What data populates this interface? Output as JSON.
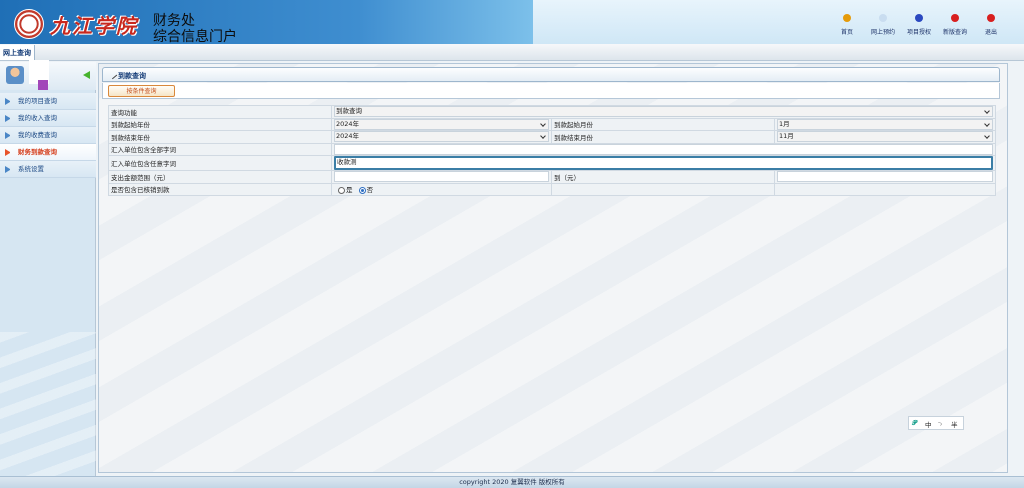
{
  "header": {
    "school_name": "九江学院",
    "title_line1": "财务处",
    "title_line2": "综合信息门户",
    "nav": [
      {
        "label": "首页",
        "color": "#e59b0b"
      },
      {
        "label": "网上预约",
        "color": "#c9ddf0"
      },
      {
        "label": "项目授权",
        "color": "#2a48c0"
      },
      {
        "label": "新版查询",
        "color": "#d81f1f"
      },
      {
        "label": "退出",
        "color": "#d81f1f"
      }
    ]
  },
  "tab": {
    "label": "网上查询"
  },
  "sidebar": {
    "items": [
      {
        "label": "我的项目查询"
      },
      {
        "label": "我的收入查询"
      },
      {
        "label": "我的收费查询"
      },
      {
        "label": "财务到款查询"
      },
      {
        "label": "系统设置"
      }
    ]
  },
  "panel": {
    "title": "到款查询",
    "query_button": "按条件查询"
  },
  "form": {
    "function_label": "查询功能",
    "function_value": "到款查询",
    "start_year_label": "到款起始年份",
    "start_year_value": "2024年",
    "start_month_label": "到款起始月份",
    "start_month_value": "1月",
    "end_year_label": "到款结束年份",
    "end_year_value": "2024年",
    "end_month_label": "到款结束月份",
    "end_month_value": "11月",
    "all_keywords_label": "汇入单位包含全部字词",
    "all_keywords_value": "",
    "any_keywords_label": "汇入单位包含任意字词",
    "any_keywords_value": "收款测",
    "amount_range_label": "支出金额范围（元）",
    "amount_from_value": "",
    "amount_to_label": "到（元）",
    "amount_to_value": "",
    "include_label": "是否包含已核销到款",
    "radio_yes": "是",
    "radio_no": "否"
  },
  "ime": {
    "a": "中",
    "b": "·₎",
    "c": "半"
  },
  "footer": {
    "text": "copyright 2020 复翼软件 版权所有"
  }
}
